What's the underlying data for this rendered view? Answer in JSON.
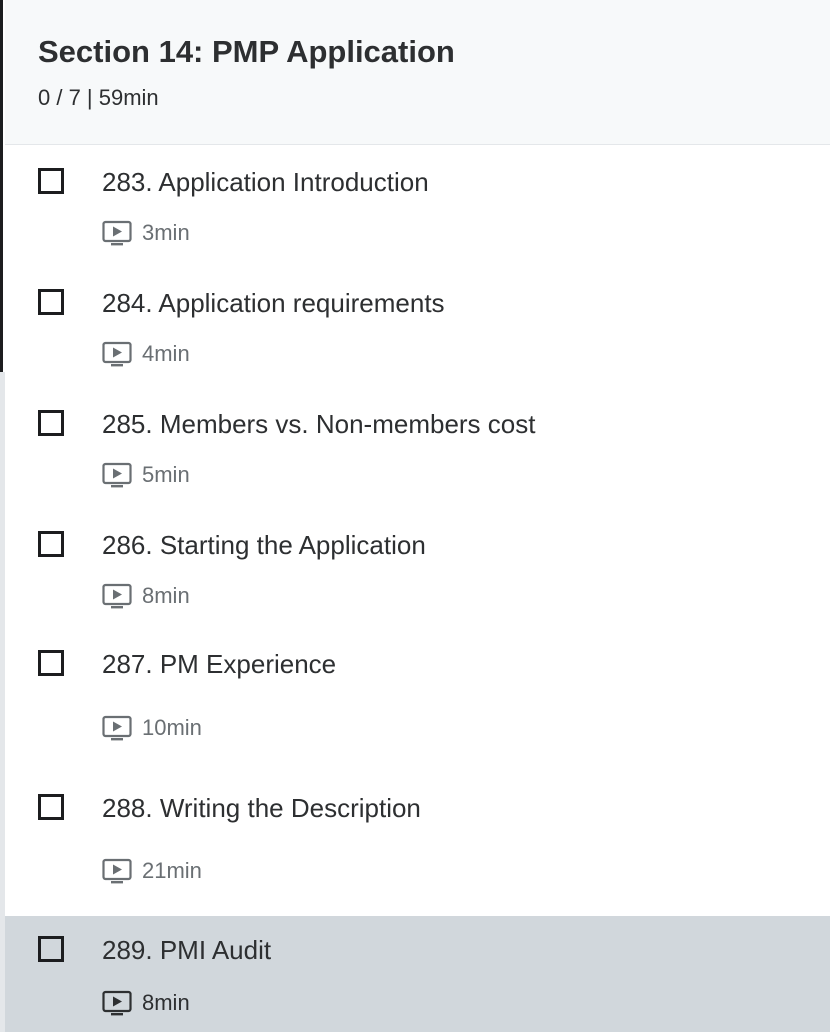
{
  "section": {
    "title": "Section 14: PMP Application",
    "meta": "0 / 7 | 59min"
  },
  "lectures": [
    {
      "title": "283. Application Introduction",
      "duration": "3min",
      "icon": "video-icon",
      "completed": false,
      "active": false
    },
    {
      "title": "284. Application requirements",
      "duration": "4min",
      "icon": "video-icon",
      "completed": false,
      "active": false
    },
    {
      "title": "285. Members vs. Non-members cost",
      "duration": "5min",
      "icon": "video-icon",
      "completed": false,
      "active": false
    },
    {
      "title": "286. Starting the Application",
      "duration": "8min",
      "icon": "video-icon",
      "completed": false,
      "active": false
    },
    {
      "title": "287. PM Experience",
      "duration": "10min",
      "icon": "video-icon",
      "completed": false,
      "active": false
    },
    {
      "title": "288. Writing the Description",
      "duration": "21min",
      "icon": "video-icon",
      "completed": false,
      "active": false
    },
    {
      "title": "289. PMI Audit",
      "duration": "8min",
      "icon": "video-icon",
      "completed": false,
      "active": true
    }
  ],
  "colors": {
    "header_bg": "#f7f9fa",
    "active_row_bg": "#d1d7dc",
    "text": "#2d2f31",
    "muted_text": "#6a6f73",
    "checkbox_border": "#1c1d1f"
  }
}
